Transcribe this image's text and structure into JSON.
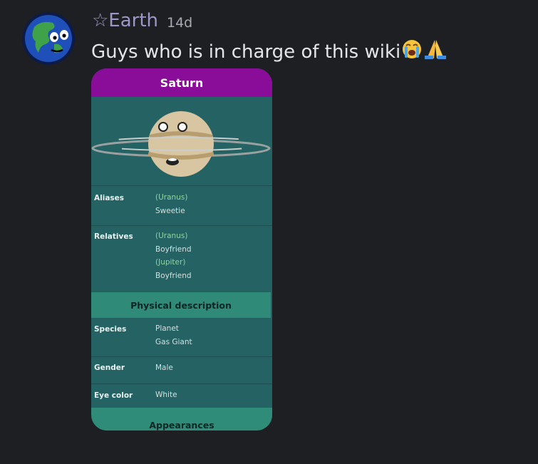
{
  "message": {
    "username": "☆Earth",
    "timestamp": "14d",
    "text": "Guys who is in charge of this wiki",
    "emojis": [
      "loudly-crying-face",
      "folded-hands"
    ]
  },
  "card": {
    "title": "Saturn",
    "image": "saturn-character",
    "rows_top": [
      {
        "key": "Aliases",
        "values": [
          {
            "text": "(Uranus)",
            "link": true
          },
          {
            "text": "Sweetie",
            "link": false
          }
        ]
      },
      {
        "key": "Relatives",
        "values": [
          {
            "text": "(Uranus)",
            "link": true
          },
          {
            "text": "Boyfriend",
            "link": false
          },
          {
            "text": "(Jupiter)",
            "link": true
          },
          {
            "text": "Boyfriend",
            "link": false
          }
        ]
      }
    ],
    "section1": "Physical description",
    "rows_bottom": [
      {
        "key": "Species",
        "values": [
          {
            "text": "Planet",
            "link": false
          },
          {
            "text": "Gas Giant",
            "link": false
          }
        ]
      },
      {
        "key": "Gender",
        "values": [
          {
            "text": "Male",
            "link": false
          }
        ]
      },
      {
        "key": "Eye color",
        "values": [
          {
            "text": "White",
            "link": false
          }
        ]
      }
    ],
    "section2": "Appearances"
  },
  "colors": {
    "background": "#1e1f22",
    "username": "#9d96c8",
    "card_header": "#8a0d99",
    "card_body": "#246264",
    "section": "#2f8a78"
  }
}
